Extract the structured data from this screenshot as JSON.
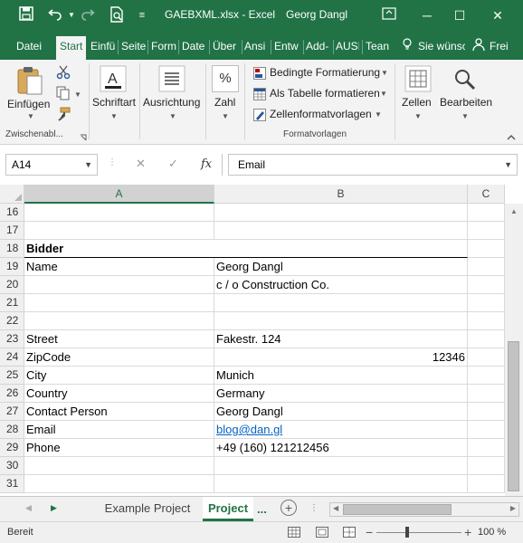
{
  "titlebar": {
    "filename": "GAEBXML.xlsx - Excel",
    "user": "Georg Dangl",
    "minimize": "─",
    "restore": "☐",
    "close": "✕"
  },
  "ribbon_tabs": {
    "items": [
      "Datei",
      "Start",
      "Einfü",
      "Seite",
      "Form",
      "Date",
      "Über",
      "Ansi",
      "Entw",
      "Add-",
      "AUSI",
      "Tean"
    ],
    "tell_me": "Sie wünsc",
    "share": "Frei"
  },
  "ribbon": {
    "einfuegen": "Einfügen",
    "schriftart": "Schriftart",
    "ausrichtung": "Ausrichtung",
    "zahl": "Zahl",
    "bedingte": "Bedingte Formatierung",
    "als_tabelle": "Als Tabelle formatieren",
    "zellenformat": "Zellenformatvorlagen",
    "zellen": "Zellen",
    "bearbeiten": "Bearbeiten",
    "group_zwischenablage": "Zwischenabl...",
    "group_formatvorlagen": "Formatvorlagen",
    "zahl_glyph": "%"
  },
  "formula_bar": {
    "name_box": "A14",
    "cancel": "✕",
    "enter": "✓",
    "fx": "fx",
    "content": "Email"
  },
  "grid": {
    "columns": [
      "A",
      "B",
      "C"
    ],
    "rows": [
      {
        "n": "16",
        "a": "",
        "b": ""
      },
      {
        "n": "17",
        "a": "",
        "b": ""
      },
      {
        "n": "18",
        "a": "Bidder",
        "b": ""
      },
      {
        "n": "19",
        "a": "Name",
        "b": "Georg Dangl"
      },
      {
        "n": "20",
        "a": "",
        "b": "c / o Construction Co."
      },
      {
        "n": "21",
        "a": "",
        "b": ""
      },
      {
        "n": "22",
        "a": "",
        "b": ""
      },
      {
        "n": "23",
        "a": "Street",
        "b": "Fakestr. 124"
      },
      {
        "n": "24",
        "a": "ZipCode",
        "b": "12346"
      },
      {
        "n": "25",
        "a": "City",
        "b": "Munich"
      },
      {
        "n": "26",
        "a": "Country",
        "b": "Germany"
      },
      {
        "n": "27",
        "a": "Contact Person",
        "b": "Georg Dangl"
      },
      {
        "n": "28",
        "a": "Email",
        "b": "blog@dan.gl"
      },
      {
        "n": "29",
        "a": "Phone",
        "b": "+49 (160) 121212456"
      },
      {
        "n": "30",
        "a": "",
        "b": ""
      },
      {
        "n": "31",
        "a": "",
        "b": ""
      }
    ]
  },
  "sheets": {
    "tabs": [
      "Example Project",
      "Project"
    ],
    "more": "...",
    "add": "+"
  },
  "status": {
    "ready": "Bereit",
    "zoom": "100 %"
  }
}
